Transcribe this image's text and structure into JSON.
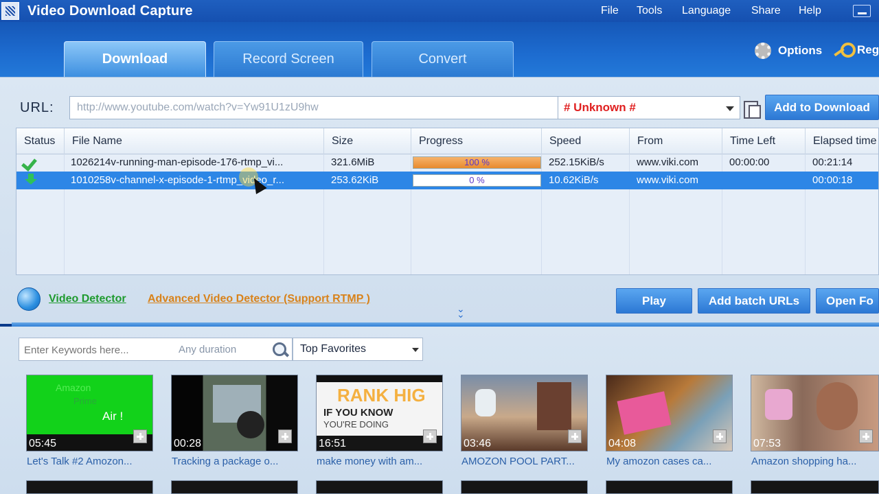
{
  "app": {
    "title": "Video Download Capture"
  },
  "menu": {
    "file": "File",
    "tools": "Tools",
    "language": "Language",
    "share": "Share",
    "help": "Help"
  },
  "tabs": {
    "download": "Download",
    "record": "Record Screen",
    "convert": "Convert"
  },
  "toolbar": {
    "options": "Options",
    "register": "Reg"
  },
  "url_bar": {
    "label": "URL:",
    "value": "http://www.youtube.com/watch?v=Yw91U1zU9hw",
    "format_selected": "# Unknown #",
    "add_button": "Add to Download"
  },
  "table": {
    "columns": [
      "Status",
      "File Name",
      "Size",
      "Progress",
      "Speed",
      "From",
      "Time Left",
      "Elapsed time"
    ],
    "rows": [
      {
        "status_icon": "check-icon",
        "file": "1026214v-running-man-episode-176-rtmp_vi...",
        "size": "321.6MiB",
        "progress_pct": 100,
        "progress_text": "100 %",
        "speed": "252.15KiB/s",
        "from": "www.viki.com",
        "time_left": "00:00:00",
        "elapsed": "00:21:14"
      },
      {
        "status_icon": "download-arrow-icon",
        "file": "1010258v-channel-x-episode-1-rtmp_video_r...",
        "size": "253.62KiB",
        "progress_pct": 0,
        "progress_text": "0 %",
        "speed": "10.62KiB/s",
        "from": "www.viki.com",
        "time_left": "",
        "elapsed": "00:00:18"
      }
    ]
  },
  "detector": {
    "video_detector": "Video Detector",
    "advanced": "Advanced Video Detector (Support RTMP )"
  },
  "actions": {
    "play": "Play",
    "batch": "Add batch URLs",
    "open_folder": "Open Fo"
  },
  "search": {
    "placeholder": "Enter Keywords here...",
    "duration": "Any duration",
    "category": "Top Favorites"
  },
  "videos": [
    {
      "duration": "05:45",
      "title": "Let's Talk #2 Amozon..."
    },
    {
      "duration": "00:28",
      "title": "Tracking a package o..."
    },
    {
      "duration": "16:51",
      "title": "make money with am..."
    },
    {
      "duration": "03:46",
      "title": "AMOZON POOL PART..."
    },
    {
      "duration": "04:08",
      "title": "My amozon cases ca..."
    },
    {
      "duration": "07:53",
      "title": "Amazon shopping ha..."
    }
  ],
  "thumb_text": {
    "amazon": "Amazon",
    "prime": "Prime",
    "air": "Air !",
    "rank": "RANK HIG",
    "know": "IF YOU KNOW",
    "doing": "YOU'RE DOING"
  },
  "colors": {
    "accent": "#2d86e6",
    "title_bar": "#1550b0",
    "format_text": "#e02020",
    "progress_fill": "#e88a2e",
    "link_green": "#1e9a2e",
    "link_orange": "#d8821a"
  }
}
